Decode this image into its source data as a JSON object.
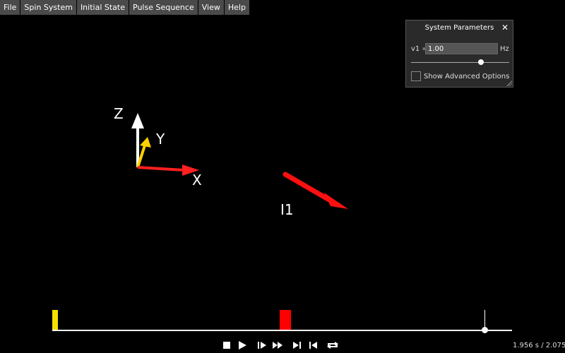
{
  "menu": {
    "items": [
      {
        "label": "File"
      },
      {
        "label": "Spin System"
      },
      {
        "label": "Initial State"
      },
      {
        "label": "Pulse Sequence"
      },
      {
        "label": "View"
      },
      {
        "label": "Help"
      }
    ]
  },
  "scene": {
    "axes": {
      "x_label": "X",
      "y_label": "Y",
      "z_label": "Z"
    },
    "vector_label": "I1",
    "colors": {
      "x_axis": "#ff2020",
      "y_axis": "#ffd000",
      "z_axis": "#ffffff",
      "vector": "#ff1010"
    }
  },
  "panel": {
    "title": "System Parameters",
    "close_icon": "close-icon",
    "param_label": "v1 =",
    "param_value": "1.00",
    "param_unit": "Hz",
    "slider_fraction": 0.72,
    "advanced_label": "Show Advanced Options",
    "advanced_checked": false
  },
  "timeline": {
    "pulse_colors": [
      "#f5e000",
      "#ff0000"
    ],
    "current_time": "1.956 s",
    "total_time": "2.075 s",
    "time_readout": "1.956 s / 2.075 s"
  },
  "controls": [
    "stop-icon",
    "play-icon",
    "step-forward-icon",
    "fast-forward-icon",
    "skip-end-icon",
    "skip-start-icon",
    "loop-icon"
  ]
}
